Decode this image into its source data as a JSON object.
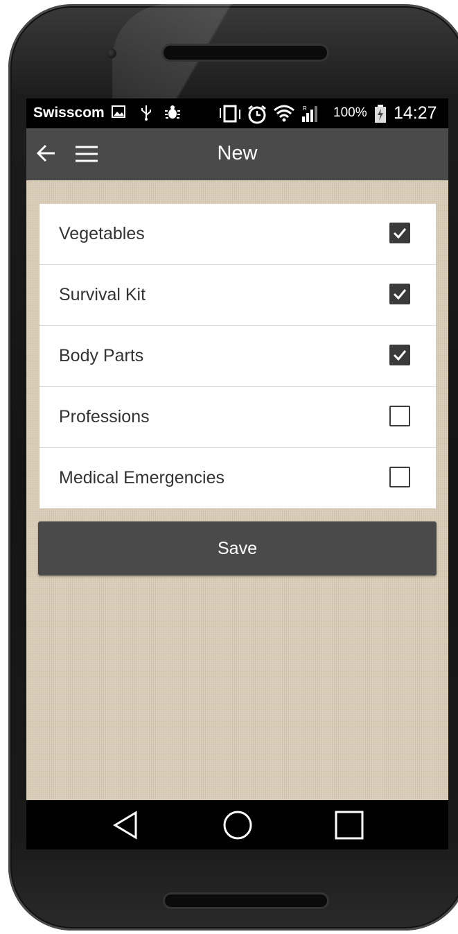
{
  "status_bar": {
    "carrier": "Swisscom",
    "battery_percent": "100%",
    "time": "14:27",
    "icons": [
      "image-icon",
      "usb-icon",
      "bug-icon",
      "vibrate-icon",
      "alarm-icon",
      "wifi-icon",
      "signal-icon",
      "battery-charging-icon"
    ]
  },
  "toolbar": {
    "title": "New",
    "back_icon": "arrow-left-icon",
    "menu_icon": "hamburger-menu-icon"
  },
  "list": {
    "items": [
      {
        "label": "Vegetables",
        "checked": true
      },
      {
        "label": "Survival Kit",
        "checked": true
      },
      {
        "label": "Body Parts",
        "checked": true
      },
      {
        "label": "Professions",
        "checked": false
      },
      {
        "label": "Medical Emergencies",
        "checked": false
      }
    ]
  },
  "actions": {
    "save_label": "Save"
  },
  "nav_bar": {
    "icons": [
      "back-triangle-icon",
      "home-circle-icon",
      "recents-square-icon"
    ]
  },
  "colors": {
    "toolbar": "#4a4a4a",
    "status_bar": "#000000",
    "background_linen": "#d9cdb8",
    "checkbox": "#3a3a3a"
  }
}
